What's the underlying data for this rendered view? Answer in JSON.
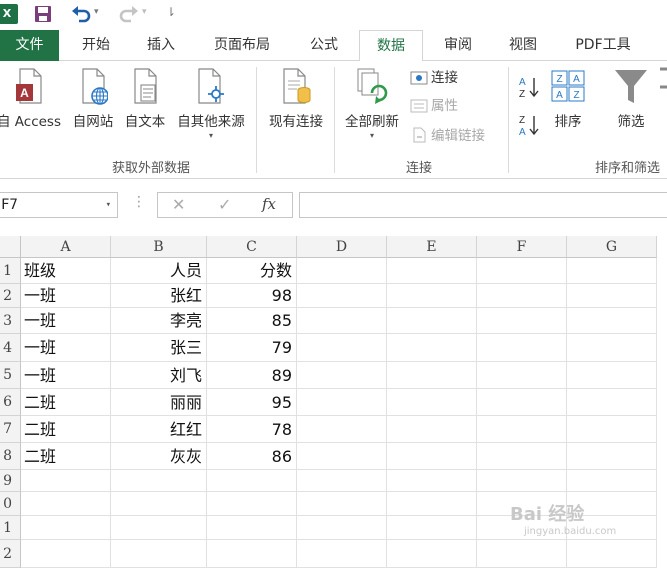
{
  "quick_access": {
    "app_icon_letter": "X",
    "undo_dropdown": "▾",
    "redo_dropdown": "▾",
    "customize": "⇂"
  },
  "tabs": [
    {
      "label": "文件",
      "name": "tab-file"
    },
    {
      "label": "开始",
      "name": "tab-home"
    },
    {
      "label": "插入",
      "name": "tab-insert"
    },
    {
      "label": "页面布局",
      "name": "tab-page-layout"
    },
    {
      "label": "公式",
      "name": "tab-formulas"
    },
    {
      "label": "数据",
      "name": "tab-data",
      "active": true
    },
    {
      "label": "审阅",
      "name": "tab-review"
    },
    {
      "label": "视图",
      "name": "tab-view"
    },
    {
      "label": "PDF工具",
      "name": "tab-pdf-tools"
    }
  ],
  "ribbon": {
    "get_external": {
      "access": "自 Access",
      "web": "自网站",
      "text": "自文本",
      "other": "自其他来源",
      "other_dropdown": "▾",
      "group_label": "获取外部数据"
    },
    "existing_connections": "现有连接",
    "connections": {
      "refresh_all": "全部刷新",
      "refresh_dropdown": "▾",
      "connections": "连接",
      "properties": "属性",
      "edit_links": "编辑链接",
      "group_label": "连接"
    },
    "sort_filter": {
      "sort_az_label": "A↓Z",
      "sort_za_label": "Z↓A",
      "sort": "排序",
      "filter": "筛选",
      "group_label": "排序和筛选"
    },
    "colors": {
      "accent": "#217346",
      "access_red": "#a4373a",
      "disabled": "#a8a8a8"
    }
  },
  "formula_bar": {
    "name_box_value": "F7",
    "name_box_arrow": "▾",
    "dots": "⋮",
    "cancel_icon": "✕",
    "enter_icon": "✓",
    "fx_label": "fx",
    "formula_value": ""
  },
  "sheet": {
    "columns": [
      "A",
      "B",
      "C",
      "D",
      "E",
      "F",
      "G"
    ],
    "row_numbers": [
      "1",
      "2",
      "3",
      "4",
      "5",
      "6",
      "7",
      "8",
      "9",
      "0",
      "1",
      "2"
    ],
    "headers": [
      "班级",
      "人员",
      "分数"
    ],
    "rows": [
      [
        "一班",
        "张红",
        "98"
      ],
      [
        "一班",
        "李亮",
        "85"
      ],
      [
        "一班",
        "张三",
        "79"
      ],
      [
        "一班",
        "刘飞",
        "89"
      ],
      [
        "二班",
        "丽丽",
        "95"
      ],
      [
        "二班",
        "红红",
        "78"
      ],
      [
        "二班",
        "灰灰",
        "86"
      ]
    ]
  },
  "watermark": {
    "text": "Bai 经验",
    "sub": "jingyan.baidu.com"
  }
}
